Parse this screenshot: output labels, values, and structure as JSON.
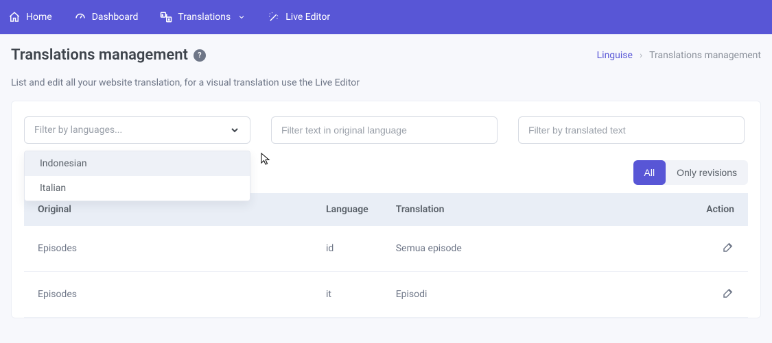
{
  "nav": {
    "home": "Home",
    "dashboard": "Dashboard",
    "translations": "Translations",
    "live_editor": "Live Editor"
  },
  "page": {
    "title": "Translations management",
    "subtext": "List and edit all your website translation, for a visual translation use the Live Editor"
  },
  "breadcrumb": {
    "root": "Linguise",
    "current": "Translations management"
  },
  "filters": {
    "lang_placeholder": "Filter by languages...",
    "original_placeholder": "Filter text in original language",
    "translated_placeholder": "Filter by translated text",
    "dropdown": {
      "indonesian": "Indonesian",
      "italian": "Italian"
    }
  },
  "toggle": {
    "all": "All",
    "revisions": "Only revisions"
  },
  "table": {
    "headers": {
      "original": "Original",
      "language": "Language",
      "translation": "Translation",
      "action": "Action"
    },
    "rows": [
      {
        "original": "Episodes",
        "lang": "id",
        "translation": "Semua episode"
      },
      {
        "original": "Episodes",
        "lang": "it",
        "translation": "Episodi"
      }
    ]
  }
}
